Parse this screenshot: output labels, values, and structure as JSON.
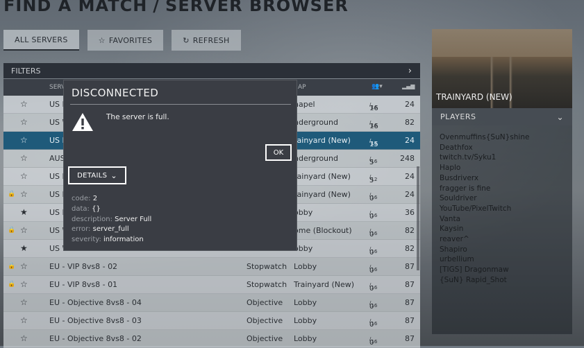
{
  "header": {
    "title_left": "FIND A MATCH",
    "separator": "/",
    "title_right": "SERVER BROWSER"
  },
  "tabs": [
    {
      "label": "ALL SERVERS",
      "icon": "",
      "active": true
    },
    {
      "label": "FAVORITES",
      "icon": "star-outline-icon",
      "active": false
    },
    {
      "label": "REFRESH",
      "icon": "refresh-icon",
      "active": false
    }
  ],
  "filters": {
    "label": "FILTERS"
  },
  "table_headers": {
    "server": "SERV",
    "map": "AP"
  },
  "servers": [
    {
      "lock": false,
      "fav": false,
      "name": "US E",
      "mode": "",
      "map": "hapel",
      "players": "16",
      "max": "16",
      "ping": "24",
      "selected": false
    },
    {
      "lock": false,
      "fav": false,
      "name": "US W",
      "mode": "",
      "map": "nderground",
      "players": "16",
      "max": "16",
      "ping": "82",
      "selected": false
    },
    {
      "lock": false,
      "fav": false,
      "name": "US E",
      "mode": "",
      "map": "rainyard (New)",
      "players": "15",
      "max": "16",
      "ping": "24",
      "selected": true
    },
    {
      "lock": false,
      "fav": false,
      "name": "AUS",
      "mode": "",
      "map": "nderground",
      "players": "5",
      "max": "16",
      "ping": "248",
      "selected": false
    },
    {
      "lock": false,
      "fav": false,
      "name": "US E",
      "mode": "",
      "map": "rainyard (New)",
      "players": "5",
      "max": "12",
      "ping": "24",
      "selected": false
    },
    {
      "lock": true,
      "fav": false,
      "name": "US E",
      "mode": "",
      "map": "rainyard (New)",
      "players": "0",
      "max": "16",
      "ping": "24",
      "selected": false
    },
    {
      "lock": false,
      "fav": true,
      "name": "US E",
      "mode": "",
      "map": "obby",
      "players": "0",
      "max": "16",
      "ping": "36",
      "selected": false
    },
    {
      "lock": true,
      "fav": false,
      "name": "US W",
      "mode": "",
      "map": "ome (Blockout)",
      "players": "0",
      "max": "16",
      "ping": "82",
      "selected": false
    },
    {
      "lock": false,
      "fav": true,
      "name": "US W",
      "mode": "",
      "map": "obby",
      "players": "0",
      "max": "16",
      "ping": "82",
      "selected": false
    },
    {
      "lock": true,
      "fav": false,
      "name": "EU - VIP 8vs8 - 02",
      "mode": "Stopwatch",
      "map": "Lobby",
      "players": "0",
      "max": "16",
      "ping": "87",
      "selected": false
    },
    {
      "lock": true,
      "fav": false,
      "name": "EU - VIP 8vs8 - 01",
      "mode": "Stopwatch",
      "map": "Trainyard (New)",
      "players": "0",
      "max": "16",
      "ping": "87",
      "selected": false
    },
    {
      "lock": false,
      "fav": false,
      "name": "EU - Objective 8vs8 - 04",
      "mode": "Objective",
      "map": "Lobby",
      "players": "0",
      "max": "16",
      "ping": "87",
      "selected": false
    },
    {
      "lock": false,
      "fav": false,
      "name": "EU - Objective 8vs8 - 03",
      "mode": "Objective",
      "map": "Lobby",
      "players": "0",
      "max": "16",
      "ping": "87",
      "selected": false
    },
    {
      "lock": false,
      "fav": false,
      "name": "EU - Objective 8vs8 - 02",
      "mode": "Objective",
      "map": "Lobby",
      "players": "0",
      "max": "16",
      "ping": "87",
      "selected": false
    }
  ],
  "side_panel": {
    "map_name": "TRAINYARD (NEW)",
    "players_header": "PLAYERS",
    "players": [
      "Ovenmuffins{SuN}shine",
      "Deathfox",
      "twitch.tv/Syku1",
      "Haplo",
      "Busdriverx",
      "fragger is fine",
      "Souldriver",
      "YouTube/PixelTwitch",
      "Vanta",
      "Kaysin",
      "reaver^",
      "Shapiro",
      "urbellium",
      "[TIGS] Dragonmaw",
      "{SuN} Rapid_Shot"
    ]
  },
  "dialog": {
    "title": "DISCONNECTED",
    "message": "The server is full.",
    "ok_label": "OK",
    "details_label": "DETAILS",
    "details": [
      {
        "key": "code",
        "value": "2"
      },
      {
        "key": "data",
        "value": "{}"
      },
      {
        "key": "description",
        "value": "Server Full"
      },
      {
        "key": "error",
        "value": "server_full"
      },
      {
        "key": "severity",
        "value": "information"
      }
    ]
  }
}
